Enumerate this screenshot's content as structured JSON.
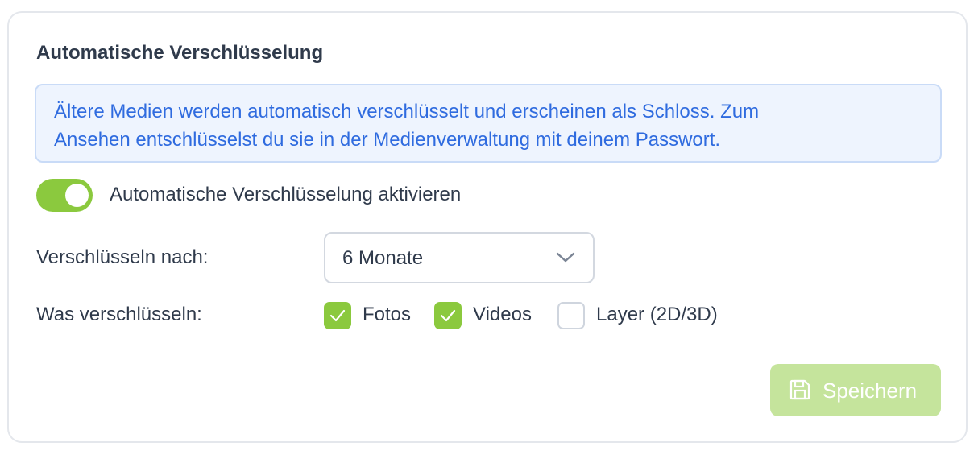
{
  "panel": {
    "title": "Automatische Verschlüsselung",
    "info_line1": "Ältere Medien werden automatisch verschlüsselt und erscheinen als Schloss. Zum",
    "info_line2": "Ansehen entschlüsselst du sie in der Medienverwaltung mit deinem Passwort."
  },
  "toggle": {
    "label": "Automatische Verschlüsselung aktivieren",
    "enabled": true
  },
  "encrypt_after": {
    "label": "Verschlüsseln nach:",
    "selected": "6 Monate"
  },
  "what_to_encrypt": {
    "label": "Was verschlüsseln:",
    "options": [
      {
        "label": "Fotos",
        "checked": true
      },
      {
        "label": "Videos",
        "checked": true
      },
      {
        "label": "Layer (2D/3D)",
        "checked": false
      }
    ]
  },
  "save_button": {
    "label": "Speichern",
    "icon": "save-icon"
  },
  "colors": {
    "accent_green": "#8bc93e",
    "disabled_green": "#c5e49c",
    "info_blue": "#2f6bdf",
    "info_bg": "#eef4fe"
  }
}
